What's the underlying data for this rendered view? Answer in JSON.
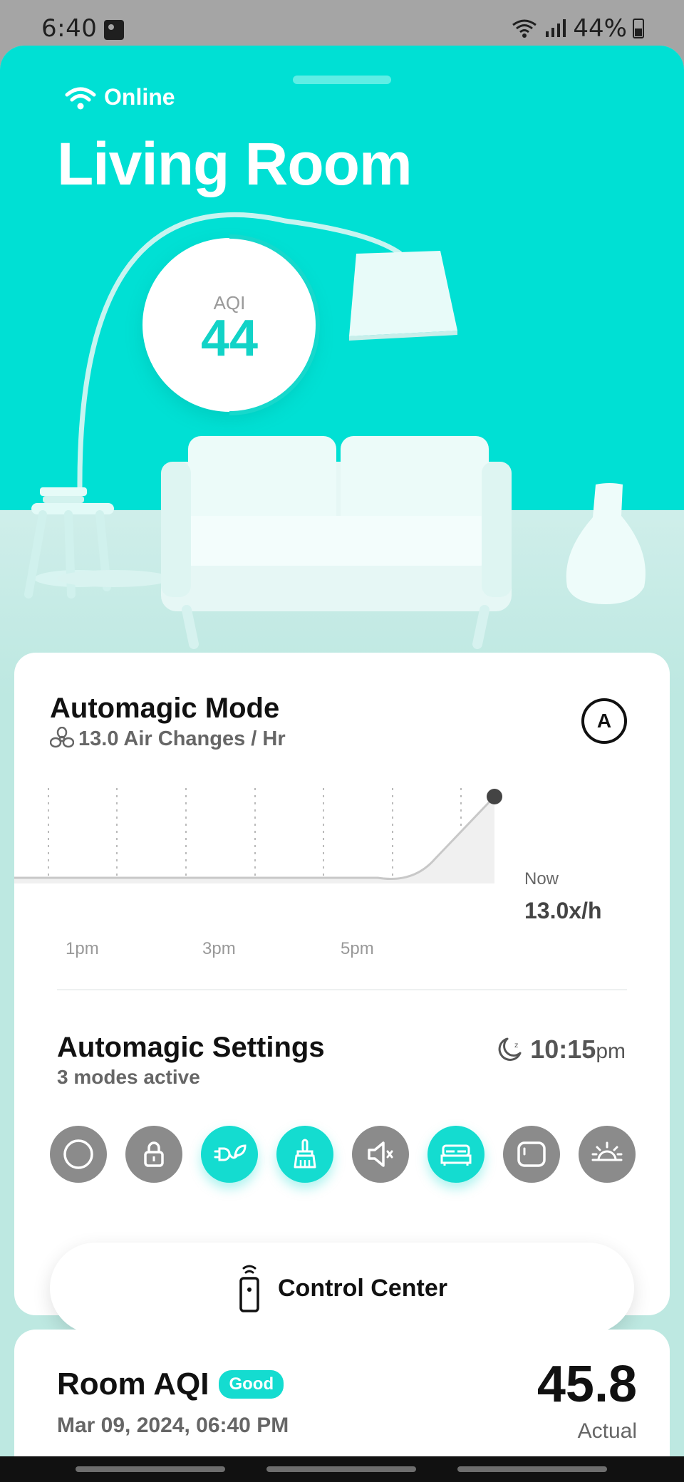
{
  "status_bar": {
    "time": "6:40",
    "battery": "44%"
  },
  "hero": {
    "online_label": "Online",
    "room_name": "Living Room",
    "aqi_label": "AQI",
    "aqi_value": "44"
  },
  "mode_card": {
    "title": "Automagic Mode",
    "subtitle": "13.0 Air Changes / Hr",
    "auto_badge": "A",
    "now_label": "Now",
    "now_value": "13.0x/h",
    "ticks": [
      "1pm",
      "3pm",
      "5pm"
    ]
  },
  "settings": {
    "title": "Automagic Settings",
    "subtitle": "3 modes active",
    "time_main": "10:15",
    "time_suffix": "pm",
    "modes": [
      {
        "name": "circle-icon",
        "active": false
      },
      {
        "name": "lock-icon",
        "active": false
      },
      {
        "name": "plug-leaf-icon",
        "active": true
      },
      {
        "name": "broom-icon",
        "active": true
      },
      {
        "name": "speaker-icon",
        "active": false
      },
      {
        "name": "bed-icon",
        "active": true
      },
      {
        "name": "display-icon",
        "active": false
      },
      {
        "name": "sunrise-icon",
        "active": false
      }
    ]
  },
  "control_center": {
    "label": "Control Center"
  },
  "room_aqi": {
    "title": "Room AQI",
    "badge": "Good",
    "date": "Mar 09, 2024, 06:40 PM",
    "value": "45.8",
    "value_label": "Actual"
  },
  "colors": {
    "accent": "#00E0D4",
    "active_mode": "#14DCD0",
    "inactive_mode": "#8B8B8B"
  }
}
